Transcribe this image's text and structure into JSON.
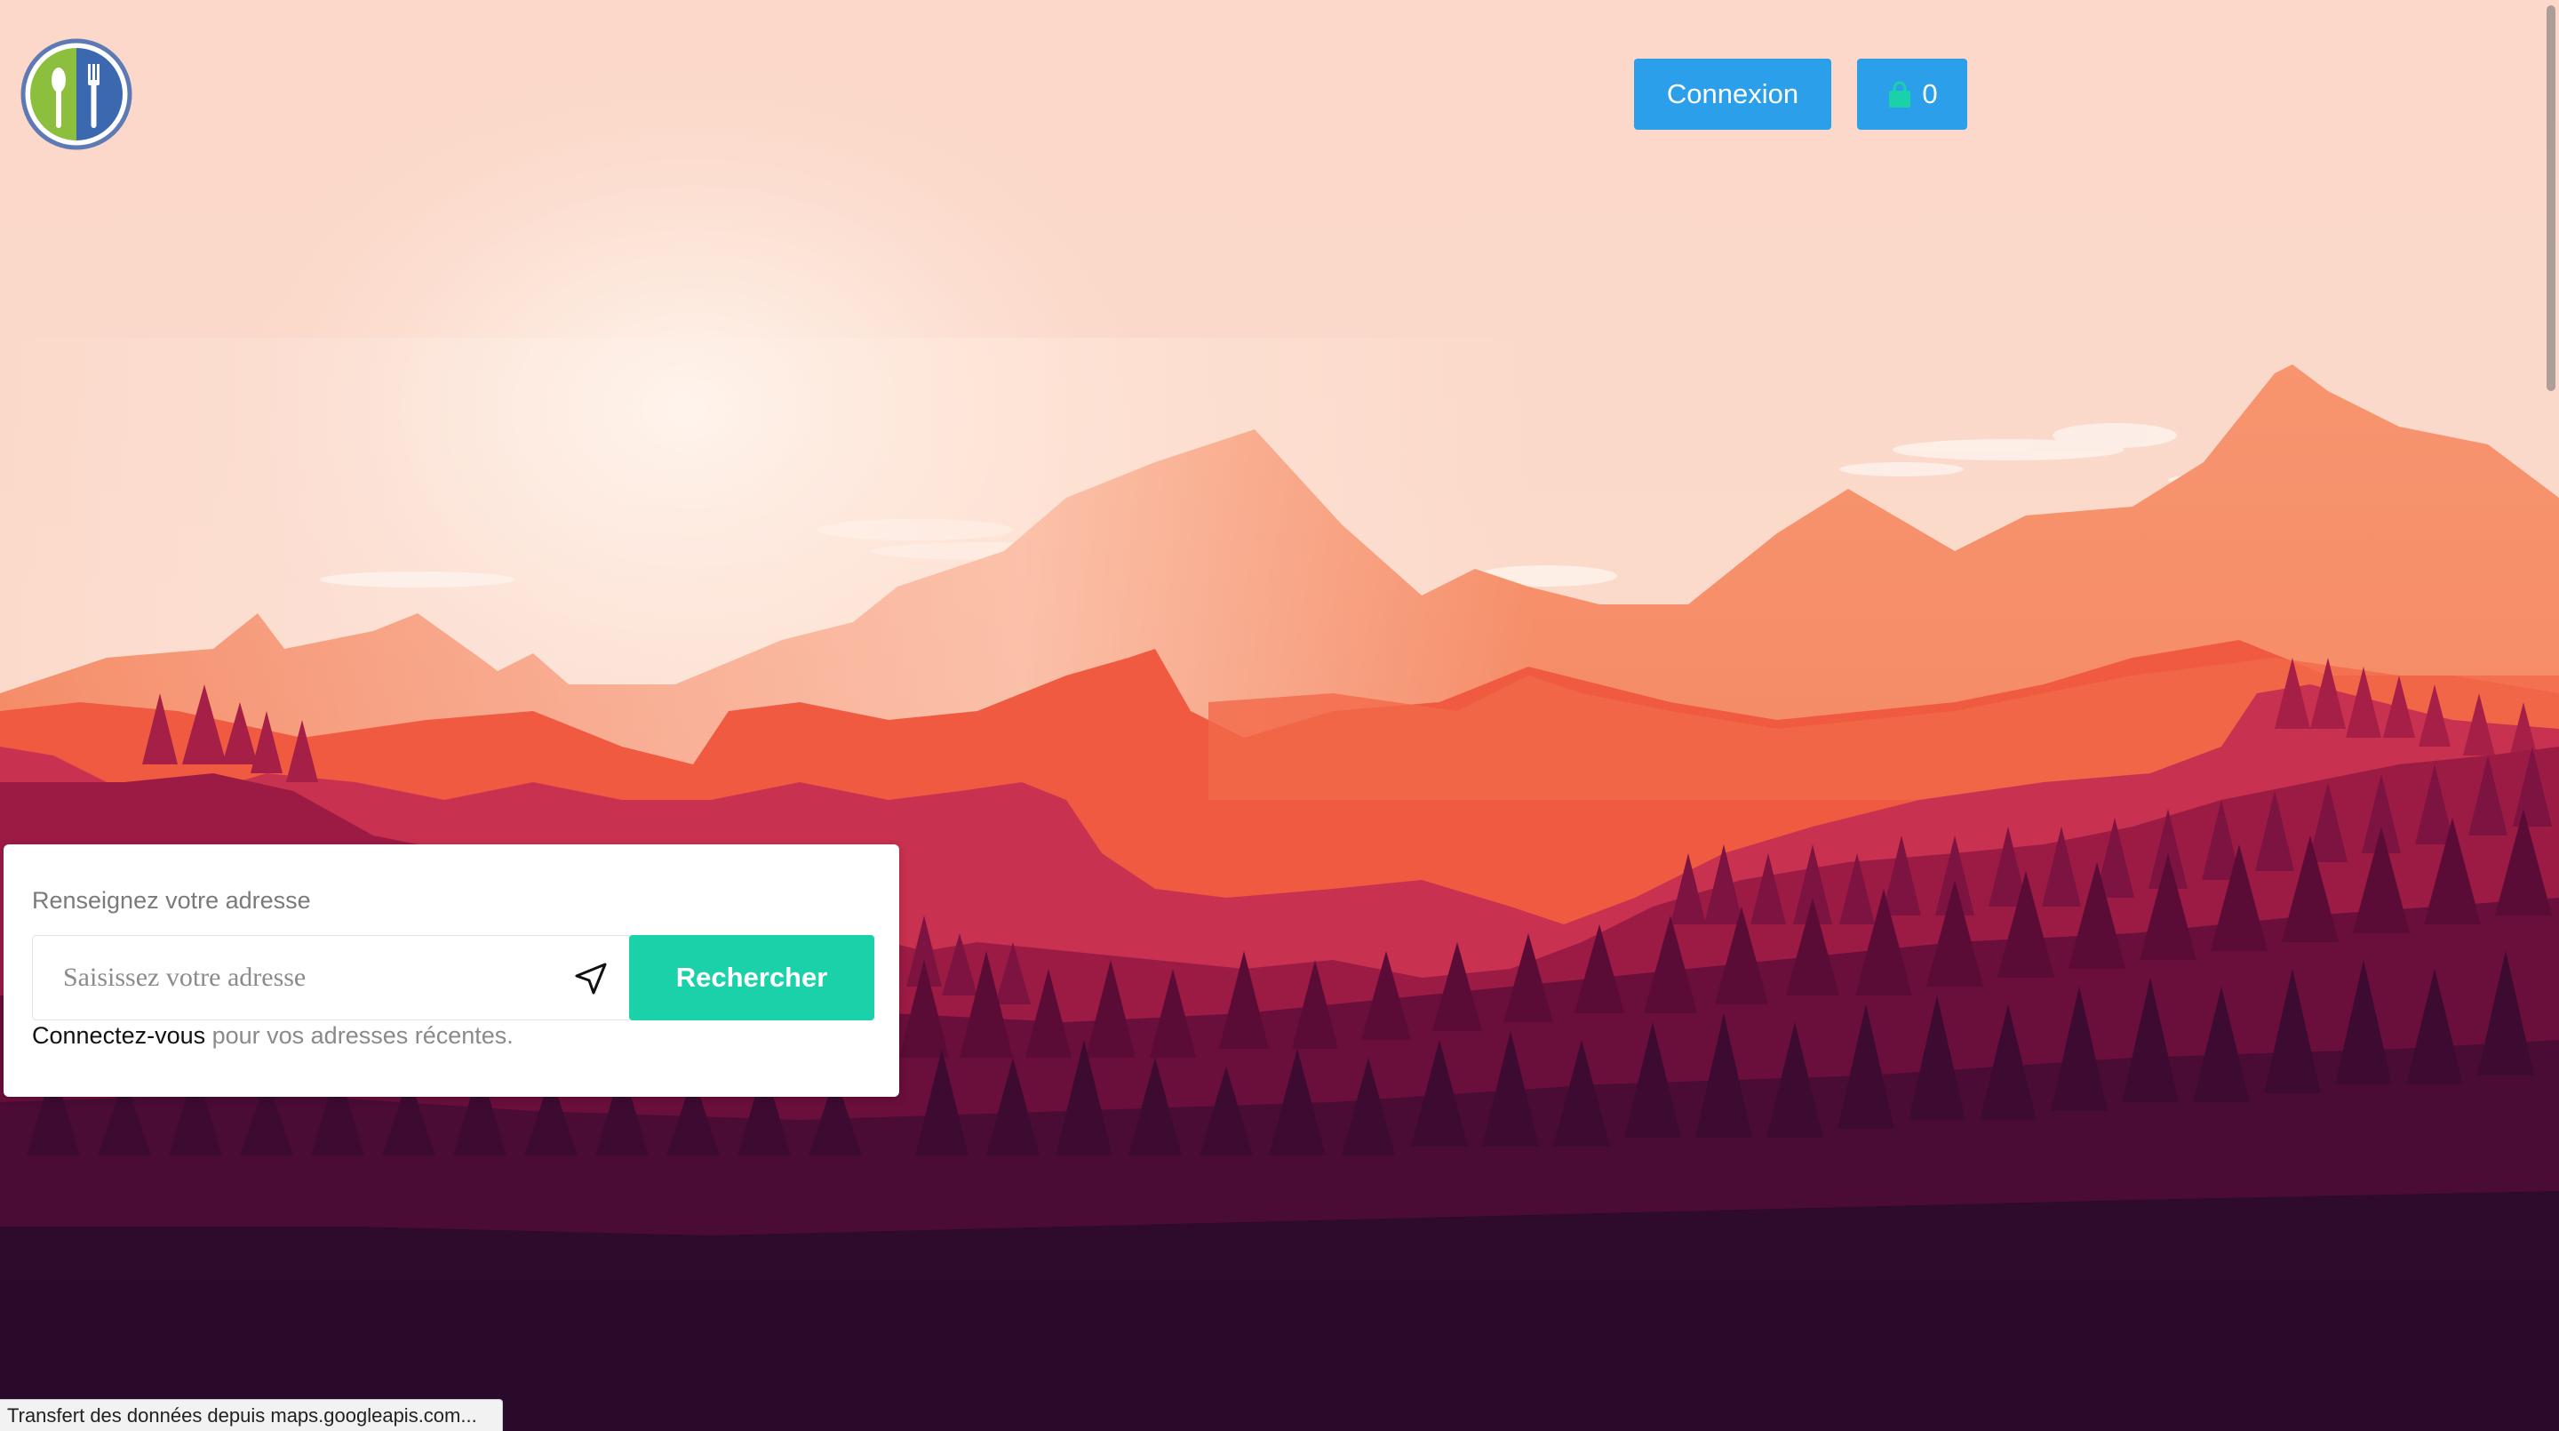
{
  "header": {
    "login_label": "Connexion",
    "cart_count": "0",
    "accent_color": "#2c9fea"
  },
  "address_card": {
    "label": "Renseignez votre adresse",
    "input_placeholder": "Saisissez votre adresse",
    "search_label": "Rechercher",
    "login_link": "Connectez-vous",
    "login_hint": " pour vos adresses récentes.",
    "accent_color": "#1ad1a9"
  },
  "status_bar": {
    "text": "Transfert des données depuis maps.googleapis.com..."
  },
  "icons": {
    "logo": "restaurant-logo-icon",
    "cart": "shopping-bag-icon",
    "locate": "location-arrow-icon"
  }
}
